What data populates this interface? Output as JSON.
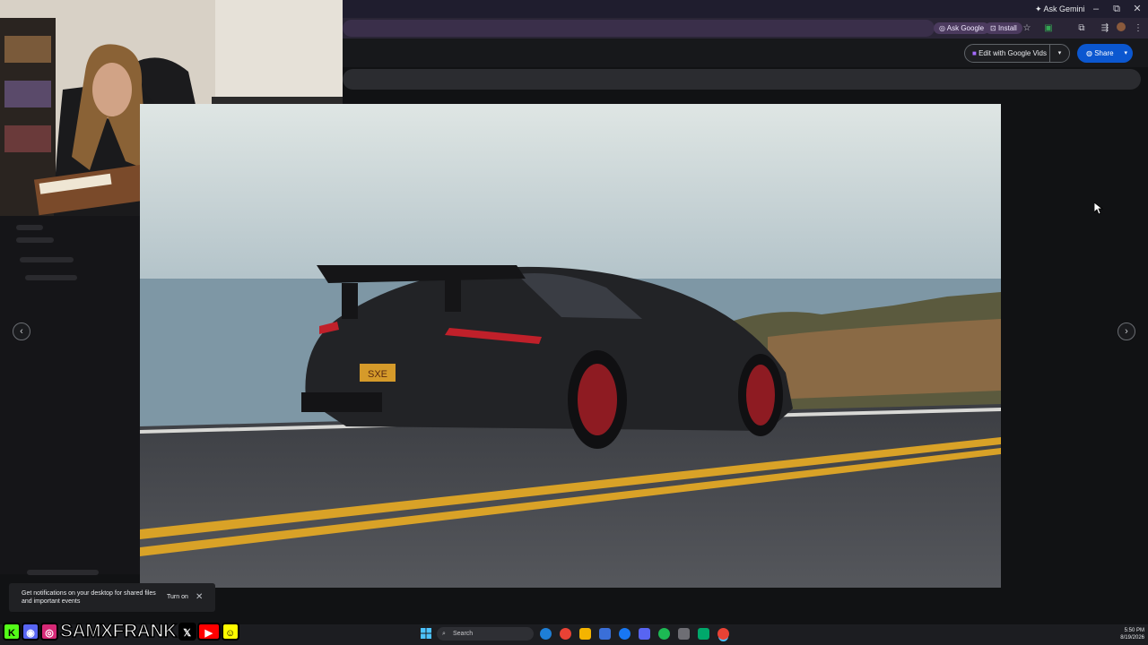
{
  "browser": {
    "ask_gemini": "Ask Gemini",
    "ask_google": "Ask Google",
    "install": "Install",
    "window_controls": {
      "minimize": "–",
      "restore": "⧉",
      "close": "✕"
    }
  },
  "app_header": {
    "edit_with_vids": "Edit with Google Vids",
    "share": "Share",
    "dropdown_glyph": "▾"
  },
  "viewer": {
    "prev_arrow": "‹",
    "next_arrow": "›",
    "plate_text": "SXE"
  },
  "toast": {
    "message": "Get notifications on your desktop for shared files and important events",
    "turn_on": "Turn on",
    "close_glyph": "✕"
  },
  "social": {
    "handle": "SAMXFRANK",
    "icons": [
      "kick-icon",
      "discord-icon",
      "instagram-icon",
      "x-icon",
      "youtube-icon",
      "snapchat-icon"
    ]
  },
  "taskbar": {
    "search_placeholder": "Search",
    "time": "5:50 PM",
    "date": "8/19/2026"
  },
  "colors": {
    "share_blue": "#0b57d0",
    "chrome_purple": "#2a2536",
    "lane_yellow": "#d9a227",
    "caliper_red": "#8e1b22"
  }
}
